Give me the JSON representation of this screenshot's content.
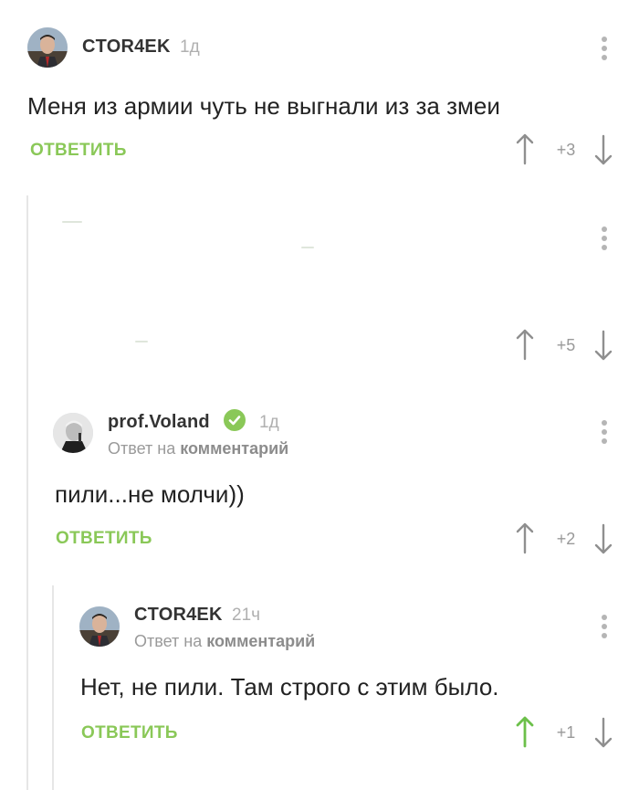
{
  "comments": [
    {
      "username": "CTOR4EK",
      "time": "1д",
      "text": "Меня из армии чуть не выгнали из за змеи",
      "reply_label": "ОТВЕТИТЬ",
      "score": "+3"
    },
    {
      "score": "+5"
    },
    {
      "username": "prof.Voland",
      "time": "1д",
      "reply_prefix": "Ответ на",
      "reply_target": "комментарий",
      "text": "пили...не молчи))",
      "reply_label": "ОТВЕТИТЬ",
      "score": "+2"
    },
    {
      "username": "CTOR4EK",
      "time": "21ч",
      "reply_prefix": "Ответ на",
      "reply_target": "комментарий",
      "text": "Нет, не пили. Там строго с этим было.",
      "reply_label": "ОТВЕТИТЬ",
      "score": "+1"
    }
  ],
  "colors": {
    "accent_green": "#8ac858",
    "muted_gray": "#b0b0b0",
    "upvoted_green": "#6cc04a"
  },
  "icons": [
    "kebab-menu-icon",
    "upvote-arrow-icon",
    "downvote-arrow-icon",
    "verified-check-icon"
  ]
}
